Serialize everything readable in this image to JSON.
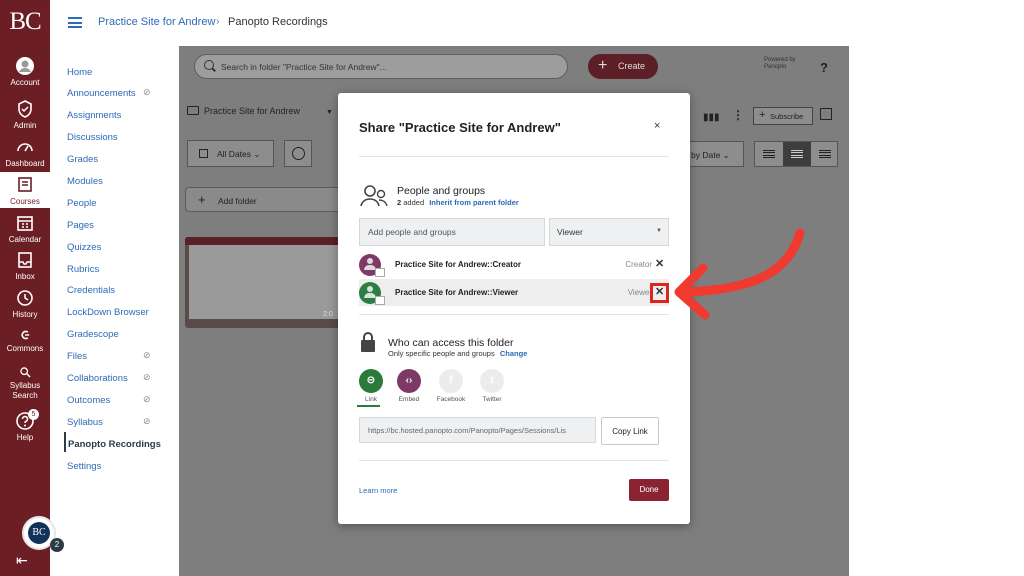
{
  "global_nav": {
    "logo": "BC",
    "items": [
      {
        "label": "Account",
        "icon": "account-icon"
      },
      {
        "label": "Admin",
        "icon": "admin-icon"
      },
      {
        "label": "Dashboard",
        "icon": "dashboard-icon"
      },
      {
        "label": "Courses",
        "icon": "courses-icon"
      },
      {
        "label": "Calendar",
        "icon": "calendar-icon"
      },
      {
        "label": "Inbox",
        "icon": "inbox-icon"
      },
      {
        "label": "History",
        "icon": "history-icon"
      },
      {
        "label": "Commons",
        "icon": "commons-icon"
      },
      {
        "label": "Syllabus Search",
        "icon": "syllabus-search-icon"
      },
      {
        "label": "Help",
        "icon": "help-icon",
        "badge": "5"
      }
    ],
    "avatar_initials": "BC",
    "avatar_badge": "2",
    "collapse_glyph": "⇤"
  },
  "header": {
    "breadcrumb": [
      "Practice Site for Andrew",
      "Panopto Recordings"
    ],
    "separator": "›"
  },
  "course_nav": {
    "items": [
      {
        "label": "Home",
        "hidden": false
      },
      {
        "label": "Announcements",
        "hidden": true
      },
      {
        "label": "Assignments",
        "hidden": false
      },
      {
        "label": "Discussions",
        "hidden": false
      },
      {
        "label": "Grades",
        "hidden": false
      },
      {
        "label": "Modules",
        "hidden": false
      },
      {
        "label": "People",
        "hidden": false
      },
      {
        "label": "Pages",
        "hidden": false
      },
      {
        "label": "Quizzes",
        "hidden": false
      },
      {
        "label": "Rubrics",
        "hidden": false
      },
      {
        "label": "Credentials",
        "hidden": false
      },
      {
        "label": "LockDown Browser",
        "hidden": false
      },
      {
        "label": "Gradescope",
        "hidden": false
      },
      {
        "label": "Files",
        "hidden": true
      },
      {
        "label": "Collaborations",
        "hidden": true
      },
      {
        "label": "Outcomes",
        "hidden": true
      },
      {
        "label": "Syllabus",
        "hidden": true
      },
      {
        "label": "Panopto Recordings",
        "hidden": false,
        "active": true
      },
      {
        "label": "Settings",
        "hidden": false
      }
    ]
  },
  "panopto": {
    "search_placeholder": "Search in folder \"Practice Site for Andrew\"...",
    "create_label": "Create",
    "powered_by": [
      "Powered by",
      "Panopto"
    ],
    "help": "?",
    "folder_name": "Practice Site for Andrew",
    "all_dates": "All Dates",
    "add_folder": "Add folder",
    "subscribe": "Subscribe",
    "sort_label": "by Date",
    "thumb_duration": "2:0"
  },
  "modal": {
    "title": "Share \"Practice Site for Andrew\"",
    "close": "×",
    "people": {
      "title": "People and groups",
      "added_count": "2",
      "added_text": "added",
      "inherit_link": "Inherit from parent folder",
      "add_placeholder": "Add people and groups",
      "role_selected": "Viewer",
      "rows": [
        {
          "name": "Practice Site for Andrew::Creator",
          "role": "Creator",
          "remove": "✕",
          "avatar_color": "#7d3a66"
        },
        {
          "name": "Practice Site for Andrew::Viewer",
          "role": "Viewer",
          "remove": "✕",
          "avatar_color": "#2e7d45"
        }
      ]
    },
    "access": {
      "title": "Who can access this folder",
      "subtitle": "Only specific people and groups",
      "change_link": "Change"
    },
    "share_options": [
      {
        "label": "Link",
        "glyph": "⊝",
        "color": "#2a7a3b",
        "icon": "link-icon"
      },
      {
        "label": "Embed",
        "glyph": "‹›",
        "color": "#7d3a66",
        "icon": "embed-icon"
      },
      {
        "label": "Facebook",
        "glyph": "f",
        "color": "#e8e8e8",
        "icon": "facebook-icon"
      },
      {
        "label": "Twitter",
        "glyph": "t",
        "color": "#e8e8e8",
        "icon": "twitter-icon"
      }
    ],
    "link_url": "https://bc.hosted.panopto.com/Panopto/Pages/Sessions/Lis",
    "copy_link": "Copy Link",
    "learn_more": "Learn more",
    "done": "Done"
  },
  "annotation": {
    "arrow_color": "#f0392f"
  }
}
